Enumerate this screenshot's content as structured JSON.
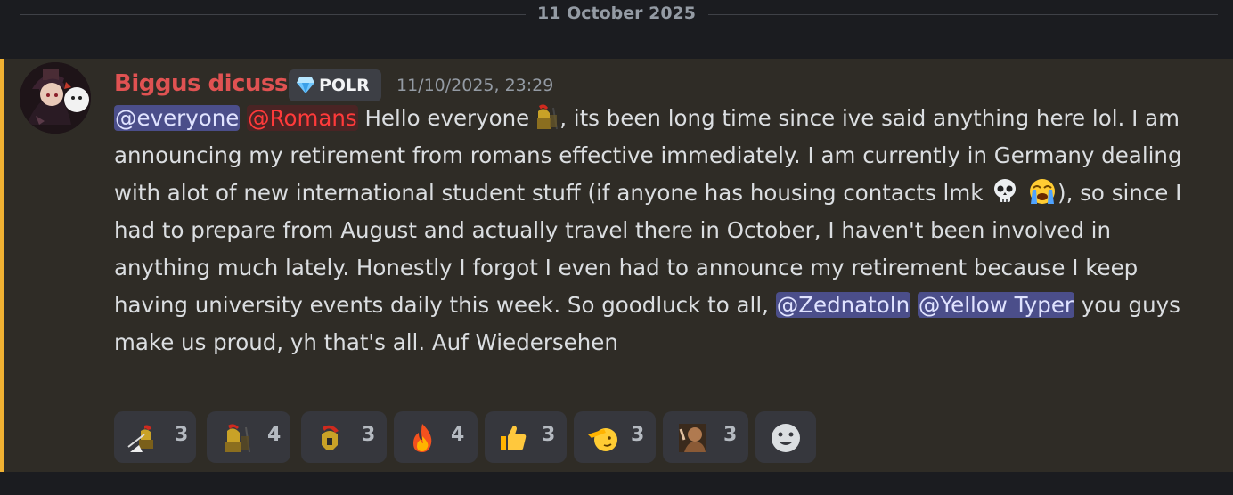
{
  "divider": {
    "date": "11 October 2025"
  },
  "message": {
    "author": "Biggus dicuss",
    "author_color": "#e05252",
    "role_tag": {
      "icon": "gem-icon",
      "label": "POLR"
    },
    "timestamp": "11/10/2025, 23:29",
    "accent_color": "#f0b132",
    "mentions": {
      "everyone": "@everyone",
      "romans": "@Romans",
      "zednatoln": "@Zednatoln",
      "yellow_typer": "@Yellow Typer"
    },
    "text": {
      "part1": " Hello everyone",
      "part2": ", its been long time since ive said anything here lol. I am announcing my retirement from romans effective immediately. I am currently in Germany dealing with alot of new international student stuff (if anyone has housing contacts lmk ",
      "part3": "), so since I had to prepare from August and actually travel there in October, I haven't been involved in anything much lately. Honestly I forgot I even had to announce my retirement because I keep having university events daily this week. So goodluck to all, ",
      "part4": " you guys   make us proud, yh that's all. Auf Wiedersehen"
    },
    "reactions": [
      {
        "emoji": "roman-soldier-spear-icon",
        "count": "3"
      },
      {
        "emoji": "roman-soldier-shield-icon",
        "count": "4"
      },
      {
        "emoji": "roman-helmet-icon",
        "count": "3"
      },
      {
        "emoji": "fire-icon",
        "count": "4"
      },
      {
        "emoji": "thumbs-up-icon",
        "count": "3"
      },
      {
        "emoji": "saluting-face-icon",
        "count": "3"
      },
      {
        "emoji": "custom-portrait-icon",
        "count": "3"
      }
    ],
    "add_reaction_icon": "add-reaction-smiley-icon"
  }
}
